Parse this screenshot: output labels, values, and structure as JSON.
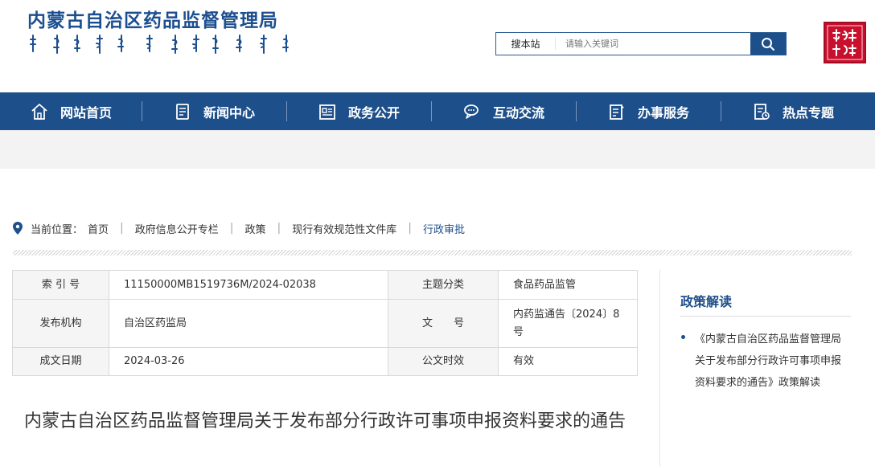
{
  "header": {
    "site_title": "内蒙古自治区药品监督管理局",
    "search": {
      "scope_label": "搜本站",
      "placeholder": "请输入关键词"
    }
  },
  "nav": {
    "items": [
      {
        "label": "网站首页",
        "icon": "home-icon"
      },
      {
        "label": "新闻中心",
        "icon": "news-icon"
      },
      {
        "label": "政务公开",
        "icon": "gov-affairs-icon"
      },
      {
        "label": "互动交流",
        "icon": "chat-icon"
      },
      {
        "label": "办事服务",
        "icon": "service-icon"
      },
      {
        "label": "热点专题",
        "icon": "topic-icon"
      }
    ]
  },
  "breadcrumb": {
    "label": "当前位置：",
    "items": [
      "首页",
      "政府信息公开专栏",
      "政策",
      "现行有效规范性文件库",
      "行政审批"
    ]
  },
  "info": {
    "index_label": "索 引 号",
    "index_value": "11150000MB1519736M/2024-02038",
    "category_label": "主题分类",
    "category_value": "食品药品监管",
    "publisher_label": "发布机构",
    "publisher_value": "自治区药监局",
    "docno_label": "文　　号",
    "docno_value": "内药监通告〔2024〕8号",
    "date_label": "成文日期",
    "date_value": "2024-03-26",
    "validity_label": "公文时效",
    "validity_value": "有效"
  },
  "document": {
    "title": "内蒙古自治区药品监督管理局关于发布部分行政许可事项申报资料要求的通告"
  },
  "side": {
    "title": "政策解读",
    "link": "《内蒙古自治区药品监督管理局关于发布部分行政许可事项申报资料要求的通告》政策解读"
  },
  "colors": {
    "primary": "#1d4f8a",
    "title": "#1c4f8f",
    "seal": "#c8102e"
  }
}
